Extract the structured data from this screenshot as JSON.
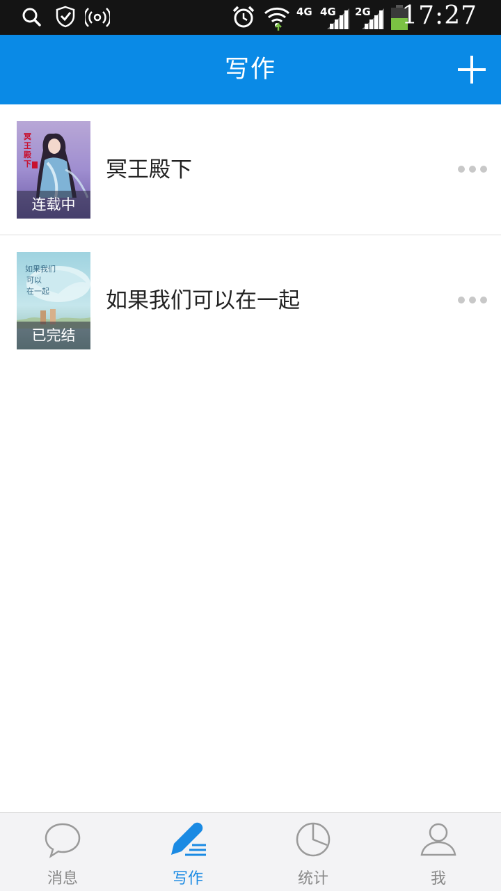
{
  "status_bar": {
    "net_labels": [
      "4G",
      "4G",
      "2G"
    ],
    "time": "17:27"
  },
  "header": {
    "title": "写作",
    "add_icon": "plus-icon"
  },
  "books": [
    {
      "title": "冥王殿下",
      "status": "连载中",
      "cover_title": "冥王殿下"
    },
    {
      "title": "如果我们可以在一起",
      "status": "已完结",
      "cover_title": "如果我们可以在一起"
    }
  ],
  "tabs": [
    {
      "label": "消息",
      "icon": "chat-bubble-icon",
      "active": false
    },
    {
      "label": "写作",
      "icon": "pencil-icon",
      "active": true
    },
    {
      "label": "统计",
      "icon": "pie-chart-icon",
      "active": false
    },
    {
      "label": "我",
      "icon": "person-icon",
      "active": false
    }
  ],
  "colors": {
    "accent": "#0a8ae6",
    "tab_active": "#1a8ae3",
    "tab_inactive": "#888888"
  }
}
